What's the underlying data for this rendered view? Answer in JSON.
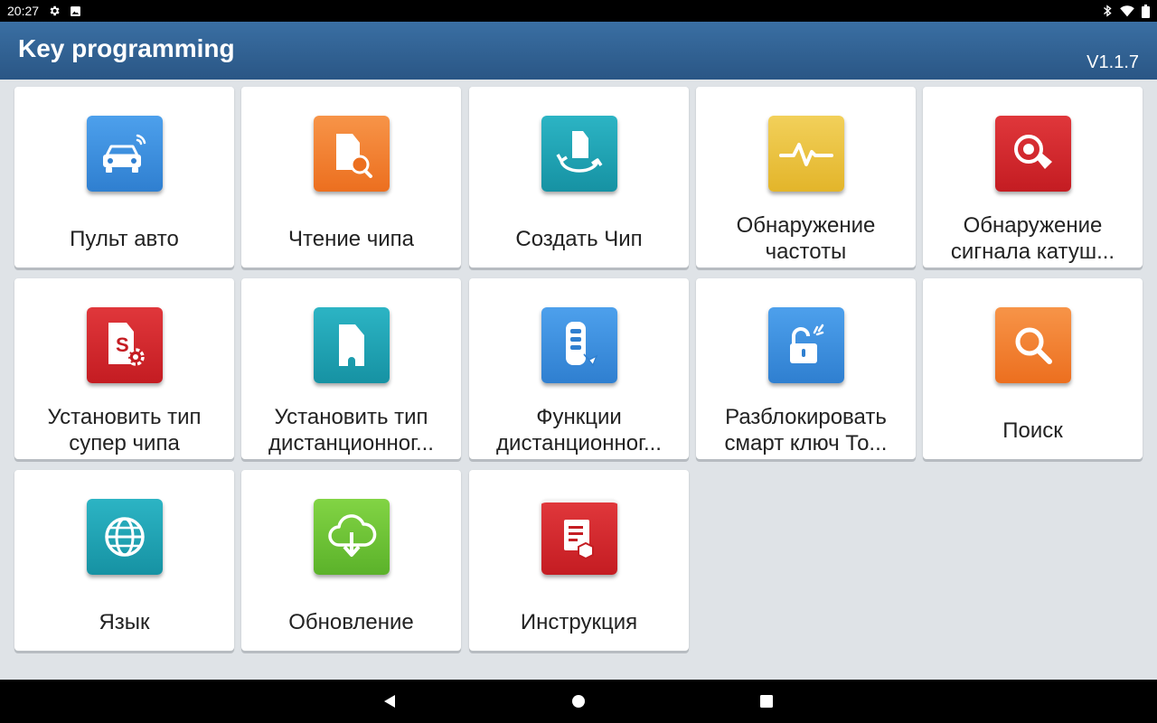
{
  "status_bar": {
    "time": "20:27",
    "left_icons": [
      "gear-icon",
      "image-icon"
    ],
    "right_icons": [
      "bluetooth-icon",
      "wifi-icon",
      "battery-icon"
    ]
  },
  "header": {
    "title": "Key programming",
    "version": "V1.1.7",
    "color": "#2f5f91"
  },
  "tiles": [
    {
      "label": "Пульт авто",
      "icon": "car-remote-icon",
      "color": "#2f86d8"
    },
    {
      "label": "Чтение чипа",
      "icon": "chip-read-icon",
      "color": "#f07d2e"
    },
    {
      "label": "Создать Чип",
      "icon": "create-chip-icon",
      "color": "#1fa0b0"
    },
    {
      "label": "Обнаружение частоты",
      "icon": "frequency-icon",
      "color": "#e9c23c"
    },
    {
      "label": "Обнаружение сигнала катуш...",
      "icon": "coil-signal-icon",
      "color": "#d3262b"
    },
    {
      "label": "Установить тип супер чипа",
      "icon": "super-chip-icon",
      "color": "#d3262b"
    },
    {
      "label": "Установить тип дистанционног...",
      "icon": "remote-type-icon",
      "color": "#1fa0b0"
    },
    {
      "label": "Функции дистанционног...",
      "icon": "remote-functions-icon",
      "color": "#2f86d8"
    },
    {
      "label": "Разблокировать смарт ключ То...",
      "icon": "unlock-icon",
      "color": "#2f86d8"
    },
    {
      "label": "Поиск",
      "icon": "search-icon",
      "color": "#f07d2e"
    },
    {
      "label": "Язык",
      "icon": "globe-icon",
      "color": "#1fa0b0"
    },
    {
      "label": "Обновление",
      "icon": "cloud-download-icon",
      "color": "#6cc332"
    },
    {
      "label": "Инструкция",
      "icon": "manual-book-icon",
      "color": "#d3262b"
    }
  ],
  "nav_bar": {
    "buttons": [
      "back-icon",
      "home-icon",
      "recents-icon"
    ]
  }
}
